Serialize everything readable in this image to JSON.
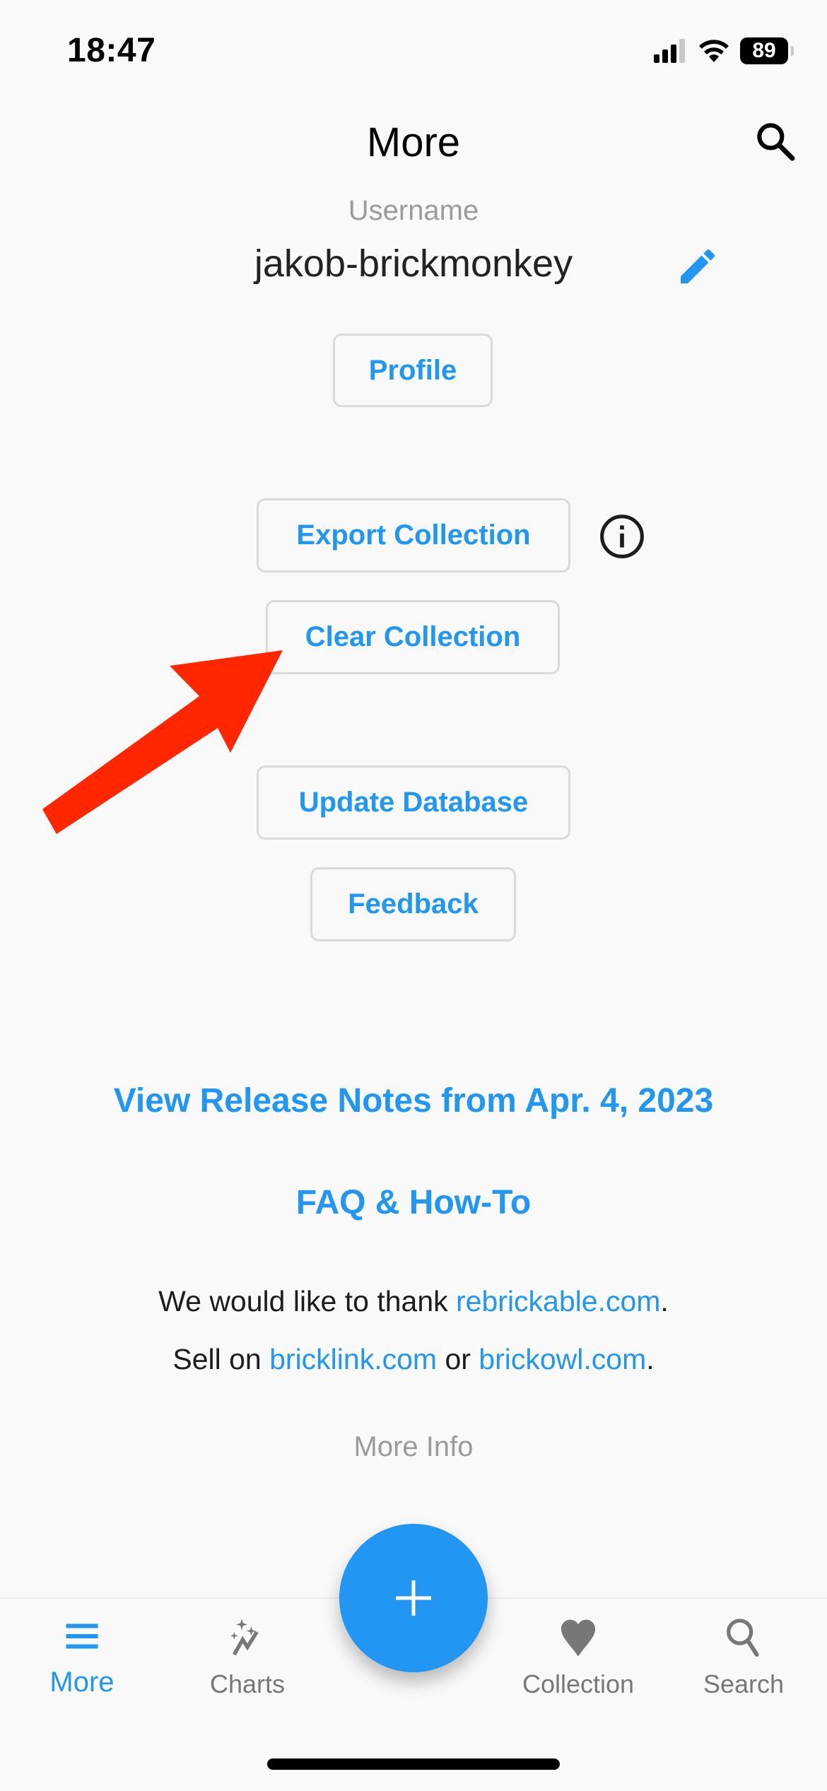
{
  "status_bar": {
    "time": "18:47",
    "battery": "89",
    "icons": [
      "signal-icon",
      "wifi-icon",
      "battery-icon"
    ]
  },
  "header": {
    "title": "More",
    "search_icon": "search-icon"
  },
  "user": {
    "label": "Username",
    "username": "jakob-brickmonkey",
    "edit_icon": "pencil-icon"
  },
  "buttons": {
    "profile": "Profile",
    "export_collection": "Export Collection",
    "clear_collection": "Clear Collection",
    "update_database": "Update Database",
    "feedback": "Feedback"
  },
  "links": {
    "release_notes": "View Release Notes from Apr. 4, 2023",
    "faq": "FAQ & How-To"
  },
  "credits": {
    "thank_prefix": "We would like to thank ",
    "thank_link": "rebrickable.com",
    "thank_suffix": ".",
    "sell_prefix": "Sell on ",
    "sell_link1": "bricklink.com",
    "sell_mid": " or ",
    "sell_link2": "brickowl.com",
    "sell_suffix": "."
  },
  "more_info": "More Info",
  "annotation": {
    "arrow_color": "#ff2600",
    "points_to": "Clear Collection"
  },
  "nav": {
    "items": [
      {
        "label": "More",
        "icon": "menu-icon",
        "active": true
      },
      {
        "label": "Charts",
        "icon": "charts-sparkle-icon",
        "active": false
      },
      {
        "label": "Collection",
        "icon": "heart-icon",
        "active": false
      },
      {
        "label": "Search",
        "icon": "search-icon",
        "active": false
      }
    ],
    "fab_icon": "plus-icon"
  },
  "colors": {
    "accent": "#2196f3",
    "background": "#f9f9f9",
    "inactive": "#777777"
  }
}
